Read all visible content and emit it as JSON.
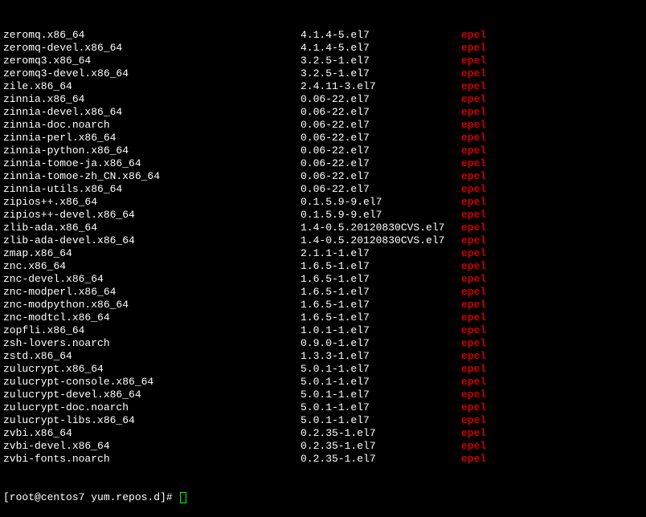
{
  "packages": [
    {
      "name": "zeromq.x86_64",
      "version": "4.1.4-5.el7",
      "repo": "epel"
    },
    {
      "name": "zeromq-devel.x86_64",
      "version": "4.1.4-5.el7",
      "repo": "epel"
    },
    {
      "name": "zeromq3.x86_64",
      "version": "3.2.5-1.el7",
      "repo": "epel"
    },
    {
      "name": "zeromq3-devel.x86_64",
      "version": "3.2.5-1.el7",
      "repo": "epel"
    },
    {
      "name": "zile.x86_64",
      "version": "2.4.11-3.el7",
      "repo": "epel"
    },
    {
      "name": "zinnia.x86_64",
      "version": "0.06-22.el7",
      "repo": "epel"
    },
    {
      "name": "zinnia-devel.x86_64",
      "version": "0.06-22.el7",
      "repo": "epel"
    },
    {
      "name": "zinnia-doc.noarch",
      "version": "0.06-22.el7",
      "repo": "epel"
    },
    {
      "name": "zinnia-perl.x86_64",
      "version": "0.06-22.el7",
      "repo": "epel"
    },
    {
      "name": "zinnia-python.x86_64",
      "version": "0.06-22.el7",
      "repo": "epel"
    },
    {
      "name": "zinnia-tomoe-ja.x86_64",
      "version": "0.06-22.el7",
      "repo": "epel"
    },
    {
      "name": "zinnia-tomoe-zh_CN.x86_64",
      "version": "0.06-22.el7",
      "repo": "epel"
    },
    {
      "name": "zinnia-utils.x86_64",
      "version": "0.06-22.el7",
      "repo": "epel"
    },
    {
      "name": "zipios++.x86_64",
      "version": "0.1.5.9-9.el7",
      "repo": "epel"
    },
    {
      "name": "zipios++-devel.x86_64",
      "version": "0.1.5.9-9.el7",
      "repo": "epel"
    },
    {
      "name": "zlib-ada.x86_64",
      "version": "1.4-0.5.20120830CVS.el7",
      "repo": "epel"
    },
    {
      "name": "zlib-ada-devel.x86_64",
      "version": "1.4-0.5.20120830CVS.el7",
      "repo": "epel"
    },
    {
      "name": "zmap.x86_64",
      "version": "2.1.1-1.el7",
      "repo": "epel"
    },
    {
      "name": "znc.x86_64",
      "version": "1.6.5-1.el7",
      "repo": "epel"
    },
    {
      "name": "znc-devel.x86_64",
      "version": "1.6.5-1.el7",
      "repo": "epel"
    },
    {
      "name": "znc-modperl.x86_64",
      "version": "1.6.5-1.el7",
      "repo": "epel"
    },
    {
      "name": "znc-modpython.x86_64",
      "version": "1.6.5-1.el7",
      "repo": "epel"
    },
    {
      "name": "znc-modtcl.x86_64",
      "version": "1.6.5-1.el7",
      "repo": "epel"
    },
    {
      "name": "zopfli.x86_64",
      "version": "1.0.1-1.el7",
      "repo": "epel"
    },
    {
      "name": "zsh-lovers.noarch",
      "version": "0.9.0-1.el7",
      "repo": "epel"
    },
    {
      "name": "zstd.x86_64",
      "version": "1.3.3-1.el7",
      "repo": "epel"
    },
    {
      "name": "zulucrypt.x86_64",
      "version": "5.0.1-1.el7",
      "repo": "epel"
    },
    {
      "name": "zulucrypt-console.x86_64",
      "version": "5.0.1-1.el7",
      "repo": "epel"
    },
    {
      "name": "zulucrypt-devel.x86_64",
      "version": "5.0.1-1.el7",
      "repo": "epel"
    },
    {
      "name": "zulucrypt-doc.noarch",
      "version": "5.0.1-1.el7",
      "repo": "epel"
    },
    {
      "name": "zulucrypt-libs.x86_64",
      "version": "5.0.1-1.el7",
      "repo": "epel"
    },
    {
      "name": "zvbi.x86_64",
      "version": "0.2.35-1.el7",
      "repo": "epel"
    },
    {
      "name": "zvbi-devel.x86_64",
      "version": "0.2.35-1.el7",
      "repo": "epel"
    },
    {
      "name": "zvbi-fonts.noarch",
      "version": "0.2.35-1.el7",
      "repo": "epel"
    }
  ],
  "prompt": "[root@centos7 yum.repos.d]# "
}
